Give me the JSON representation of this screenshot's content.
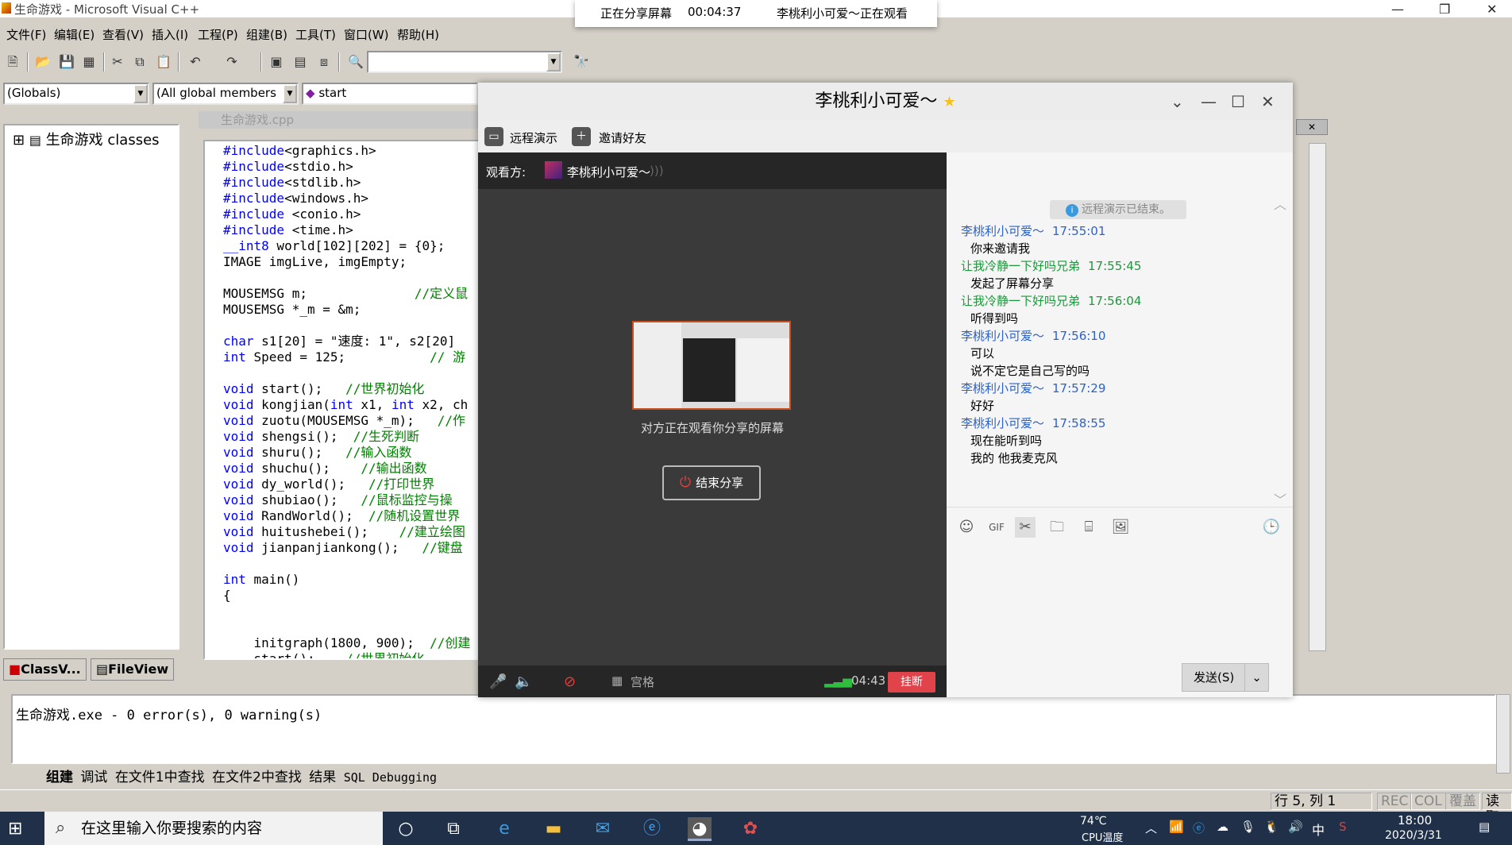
{
  "vc": {
    "title": "生命游戏 - Microsoft Visual C++",
    "menu": [
      "文件(F)",
      "编辑(E)",
      "查看(V)",
      "插入(I)",
      "工程(P)",
      "组建(B)",
      "工具(T)",
      "窗口(W)",
      "帮助(H)"
    ],
    "combo_globals": "(Globals)",
    "combo_members": "(All global members",
    "combo_func": "start",
    "class_root": "生命游戏 classes",
    "tab_classview": "ClassV...",
    "tab_fileview": "FileView",
    "editor_title": "生命游戏.cpp",
    "output_text": "生命游戏.exe - 0 error(s), 0 warning(s)",
    "output_tabs": [
      "组建",
      "调试",
      "在文件1中查找",
      "在文件2中查找",
      "结果",
      "SQL Debugging"
    ],
    "status_pos": "行 5, 列 1",
    "status_flags": [
      "REC",
      "COL",
      "覆盖",
      "读取"
    ]
  },
  "code_lines": [
    "#include<graphics.h>",
    "#include<stdio.h>",
    "#include<stdlib.h>",
    "#include<windows.h>",
    "#include <conio.h>",
    "#include <time.h>",
    "__int8 world[102][202] = {0};",
    "IMAGE imgLive, imgEmpty;",
    "",
    "MOUSEMSG m;              //定义鼠",
    "MOUSEMSG *_m = &m;",
    "",
    "char s1[20] = \"速度: 1\", s2[20]",
    "int Speed = 125;           // 游",
    "",
    "void start();   //世界初始化",
    "void kongjian(int x1, int x2, ch",
    "void zuotu(MOUSEMSG *_m);   //作",
    "void shengsi();  //生死判断",
    "void shuru();   //输入函数",
    "void shuchu();    //输出函数",
    "void dy_world();   //打印世界",
    "void shubiao();   //鼠标监控与操",
    "void RandWorld();  //随机设置世界",
    "void huitushebei();    //建立绘图",
    "void jianpanjiankong();   //键盘",
    "",
    "int main()",
    "{",
    "",
    "",
    "    initgraph(1800, 900);  //创建",
    "    start();    //世界初始化"
  ],
  "share_bar": {
    "status": "正在分享屏幕",
    "time": "00:04:37",
    "watcher": "李桃利小可爱～正在观看"
  },
  "qq": {
    "title": "李桃利小可爱～",
    "tool_remote": "远程演示",
    "tool_invite": "邀请好友",
    "viewer_label": "观看方:",
    "viewer_name": "李桃利小可爱～",
    "watching_msg": "对方正在观看你分享的屏幕",
    "end_share": "结束分享",
    "grid_label": "宫格",
    "call_time": "04:43",
    "hangup": "挂断",
    "notice": "远程演示已结束。",
    "messages": [
      {
        "who": "李桃利小可爱～",
        "time": "17:55:01",
        "side": "a",
        "texts": [
          "你来邀请我"
        ]
      },
      {
        "who": "让我冷静一下好吗兄弟",
        "time": "17:55:45",
        "side": "b",
        "texts": [
          "发起了屏幕分享"
        ]
      },
      {
        "who": "让我冷静一下好吗兄弟",
        "time": "17:56:04",
        "side": "b",
        "texts": [
          "听得到吗"
        ]
      },
      {
        "who": "李桃利小可爱～",
        "time": "17:56:10",
        "side": "a",
        "texts": [
          "可以",
          "说不定它是自己写的吗"
        ]
      },
      {
        "who": "李桃利小可爱～",
        "time": "17:57:29",
        "side": "a",
        "texts": [
          "好好"
        ]
      },
      {
        "who": "李桃利小可爱～",
        "time": "17:58:55",
        "side": "a",
        "texts": [
          "现在能听到吗",
          "我的 他我麦克风"
        ]
      }
    ],
    "send": "发送(S)"
  },
  "taskbar": {
    "search_placeholder": "在这里输入你要搜索的内容",
    "cpu_temp": "74℃",
    "cpu_label": "CPU温度",
    "ime": "中",
    "time": "18:00",
    "date": "2020/3/31"
  }
}
